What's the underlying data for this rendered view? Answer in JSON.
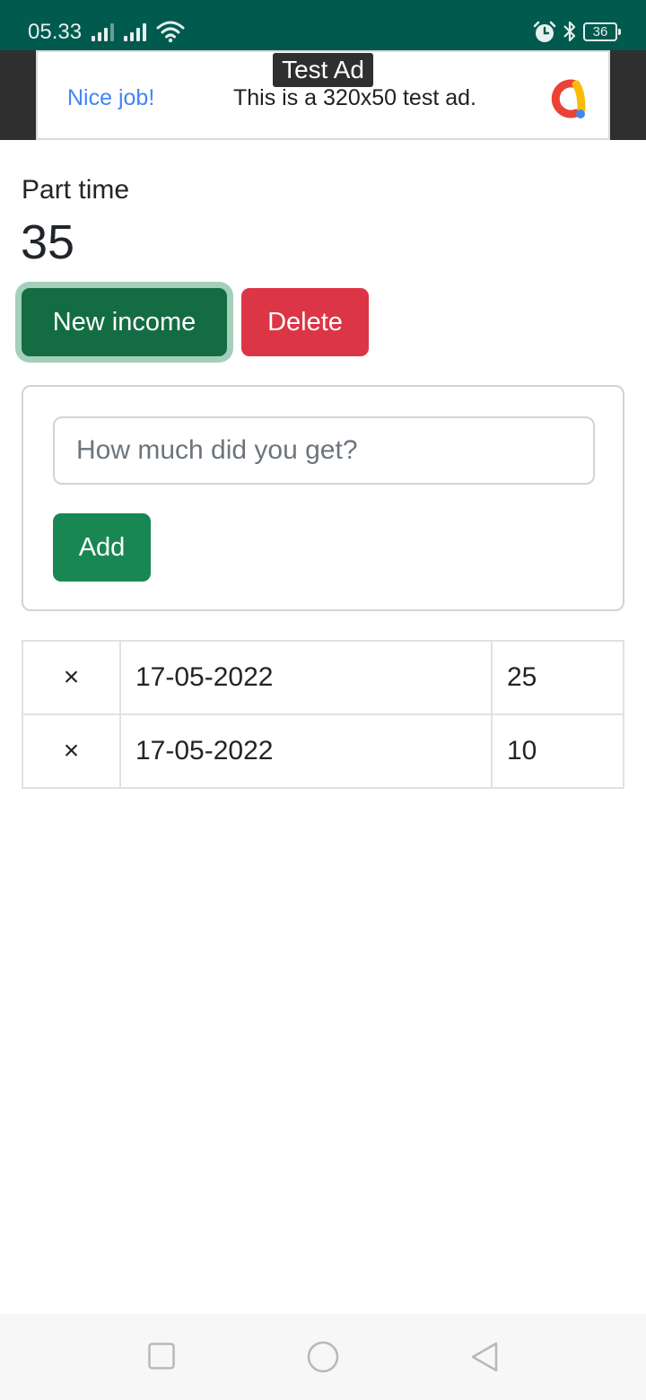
{
  "status_bar": {
    "time": "05.33",
    "battery_level": "36",
    "icons": [
      "signal-icon",
      "signal-icon",
      "wifi-icon",
      "alarm-icon",
      "bluetooth-icon",
      "battery-icon"
    ]
  },
  "ad": {
    "tag": "Test Ad",
    "headline": "Nice job!",
    "text": "This is a 320x50 test ad.",
    "logo_icon": "admob-logo-icon"
  },
  "account": {
    "name": "Part time",
    "total": "35"
  },
  "actions": {
    "new_income_label": "New income",
    "delete_label": "Delete"
  },
  "form": {
    "amount_placeholder": "How much did you get?",
    "amount_value": "",
    "add_label": "Add"
  },
  "incomes": [
    {
      "remove": "×",
      "date": "17-05-2022",
      "amount": "25"
    },
    {
      "remove": "×",
      "date": "17-05-2022",
      "amount": "10"
    }
  ],
  "nav": {
    "icons": [
      "recents-icon",
      "home-icon",
      "back-icon"
    ]
  },
  "colors": {
    "status_bar": "#005a4e",
    "primary_green": "#146c43",
    "success_green": "#198754",
    "danger_red": "#dc3545",
    "ad_link_blue": "#4285f4"
  }
}
